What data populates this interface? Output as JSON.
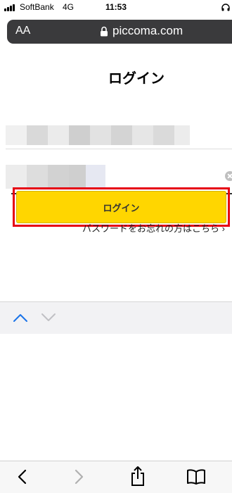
{
  "status_bar": {
    "carrier": "SoftBank",
    "network": "4G",
    "time": "11:53"
  },
  "browser": {
    "text_size_button": "AA",
    "url": "piccoma.com"
  },
  "page": {
    "title": "ログイン",
    "login_button": "ログイン",
    "forgot_password_link": "パスワードをお忘れの方はこちら ›"
  },
  "colors": {
    "login_button_bg": "#ffd600",
    "highlight_border": "#e60012",
    "accessory_arrow_active": "#1a73e8"
  },
  "icons": {
    "lock": "lock-icon",
    "clear": "clear-icon",
    "prev": "chevron-up-icon",
    "next": "chevron-down-icon",
    "back": "back-arrow-icon",
    "forward": "forward-arrow-icon",
    "share": "share-icon",
    "bookmarks": "book-icon"
  }
}
